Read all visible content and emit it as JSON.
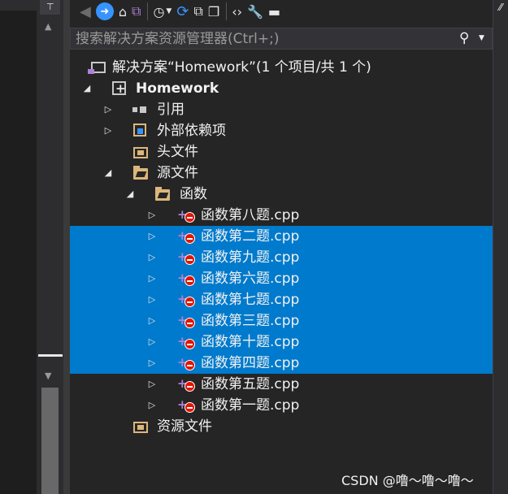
{
  "search": {
    "placeholder": "搜索解决方案资源管理器(Ctrl+;)"
  },
  "toolbar": {
    "items": [
      "back-icon",
      "forward-icon",
      "home-icon",
      "switch-views-icon",
      "pending-changes-icon",
      "sync-icon",
      "collapse-all-icon",
      "show-all-files-icon",
      "view-code-icon",
      "properties-icon",
      "preview-icon"
    ]
  },
  "tree": {
    "solution": "解决方案“Homework”(1 个项目/共 1 个)",
    "project": "Homework",
    "references": "引用",
    "external_deps": "外部依赖项",
    "headers": "头文件",
    "sources": "源文件",
    "subfolder": "函数",
    "files": [
      "函数第八题.cpp",
      "函数第二题.cpp",
      "函数第九题.cpp",
      "函数第六题.cpp",
      "函数第七题.cpp",
      "函数第三题.cpp",
      "函数第十题.cpp",
      "函数第四题.cpp",
      "函数第五题.cpp",
      "函数第一题.cpp"
    ],
    "resources": "资源文件"
  },
  "watermark": "CSDN @噜～噜～噜～",
  "colors": {
    "selection": "#007acc",
    "background": "#252526",
    "text": "#f1f1f1",
    "error": "#e51400"
  }
}
